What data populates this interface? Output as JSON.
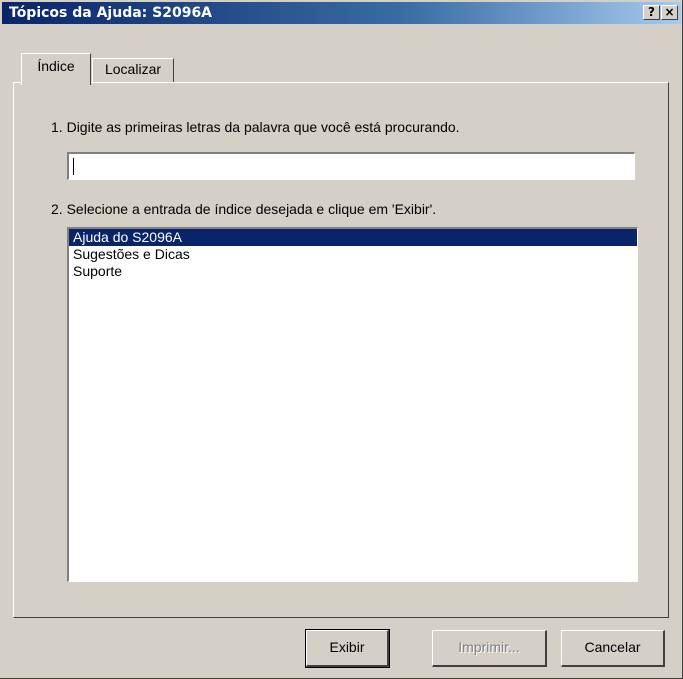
{
  "window": {
    "title": "Tópicos da Ajuda: S2096A",
    "help_button": "?",
    "close_button": "×"
  },
  "tabs": [
    {
      "label": "Índice",
      "active": true
    },
    {
      "label": "Localizar",
      "active": false
    }
  ],
  "step1": {
    "label": "1. Digite as primeiras letras da palavra que você está procurando.",
    "prefix": "1. ",
    "rest": "Digite as primeiras letras da palavra que você está procurando."
  },
  "search": {
    "value": "",
    "placeholder": ""
  },
  "step2": {
    "label": "2. Selecione a entrada de índice desejada e clique em 'Exibir'.",
    "prefix": "2. ",
    "rest": "Selecione a entrada de índice desejada e clique em 'Exibir'."
  },
  "index_list": {
    "items": [
      "Ajuda do S2096A",
      "Sugestões e Dicas",
      "Suporte"
    ],
    "selected_index": 0
  },
  "buttons": {
    "show": "Exibir",
    "print": "Imprimir...",
    "cancel": "Cancelar"
  },
  "colors": {
    "title_gradient_start": "#0a246a",
    "title_gradient_end": "#a6caf0",
    "selection": "#0a246a",
    "face": "#d4d0c8"
  }
}
